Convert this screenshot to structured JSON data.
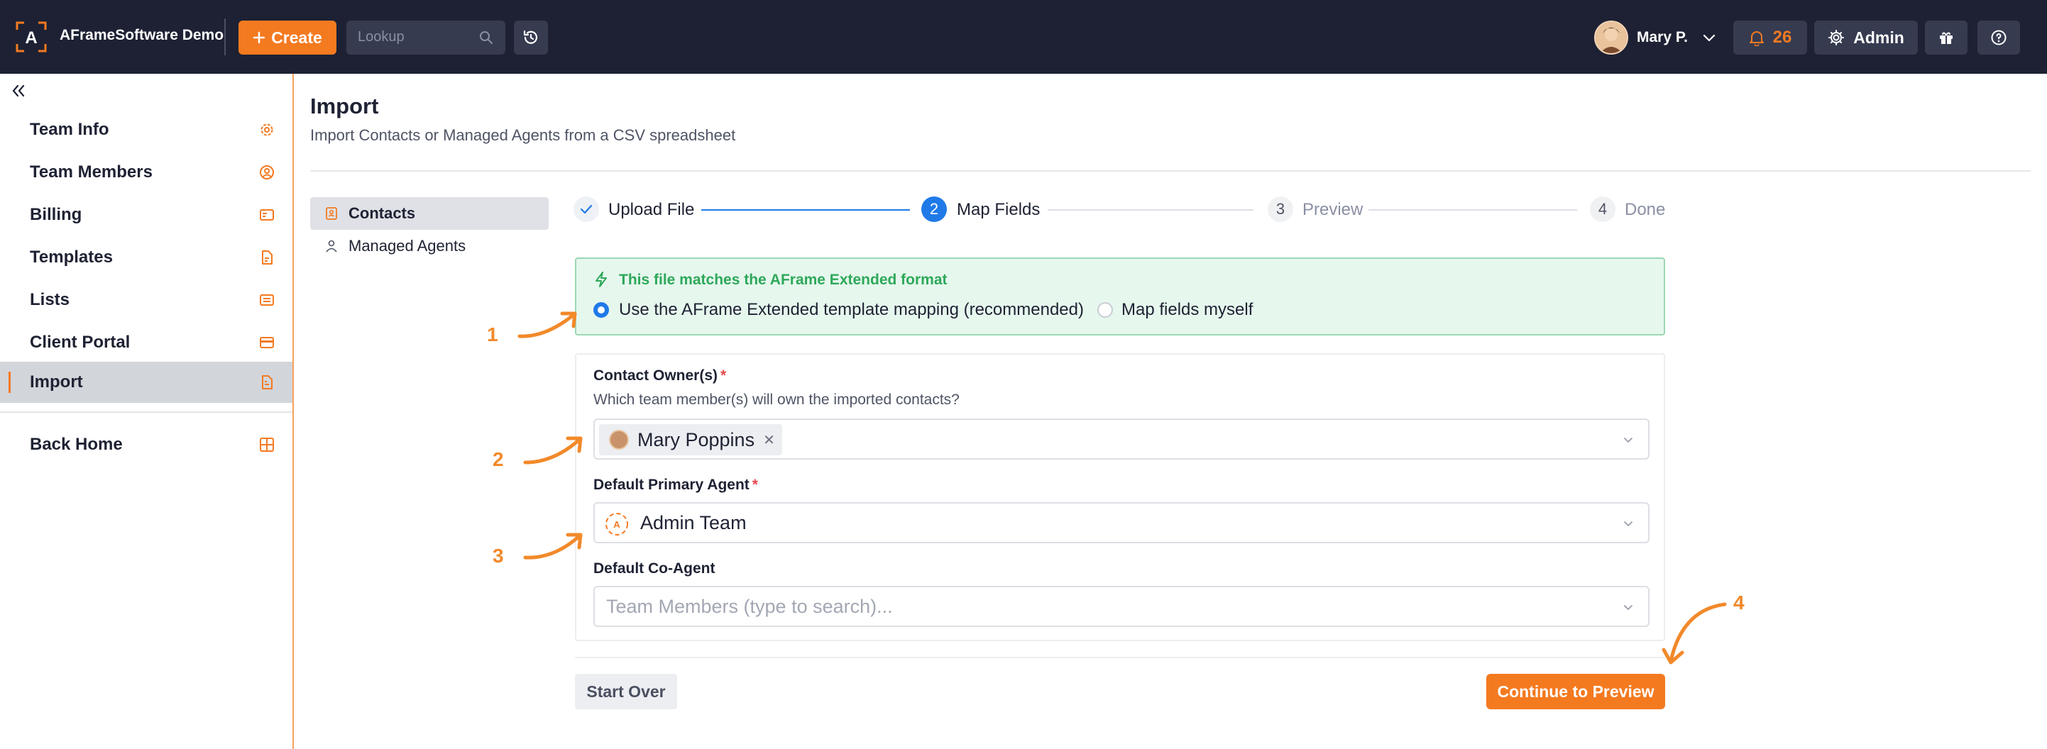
{
  "topbar": {
    "brand": "AFrameSoftware Demo",
    "create_label": "Create",
    "lookup_placeholder": "Lookup",
    "user_name": "Mary P.",
    "notification_count": "26",
    "admin_label": "Admin"
  },
  "sidebar": {
    "items": [
      {
        "label": "Team Info",
        "icon": "gear-icon"
      },
      {
        "label": "Team Members",
        "icon": "user-circle-icon"
      },
      {
        "label": "Billing",
        "icon": "card-icon"
      },
      {
        "label": "Templates",
        "icon": "document-icon"
      },
      {
        "label": "Lists",
        "icon": "list-icon"
      },
      {
        "label": "Client Portal",
        "icon": "portal-icon"
      },
      {
        "label": "Import",
        "icon": "import-file-icon",
        "active": true
      }
    ],
    "back_home": {
      "label": "Back Home",
      "icon": "grid-icon"
    }
  },
  "page": {
    "title": "Import",
    "subtitle": "Import Contacts or Managed Agents from a CSV spreadsheet"
  },
  "subnav": {
    "contacts": "Contacts",
    "managed_agents": "Managed Agents"
  },
  "stepper": {
    "steps": [
      {
        "number": "",
        "label": "Upload File",
        "state": "done"
      },
      {
        "number": "2",
        "label": "Map Fields",
        "state": "current"
      },
      {
        "number": "3",
        "label": "Preview",
        "state": "upcoming"
      },
      {
        "number": "4",
        "label": "Done",
        "state": "upcoming"
      }
    ]
  },
  "match": {
    "title": "This file matches the AFrame Extended format",
    "option_template": "Use the AFrame Extended template mapping (recommended)",
    "option_manual": "Map fields myself",
    "selected": "template"
  },
  "form": {
    "owners_label": "Contact Owner(s)",
    "owners_help": "Which team member(s) will own the imported contacts?",
    "owners_value": "Mary Poppins",
    "primary_label": "Default Primary Agent",
    "primary_value": "Admin Team",
    "coagent_label": "Default Co-Agent",
    "coagent_placeholder": "Team Members (type to search)...",
    "required_mark": "*"
  },
  "actions": {
    "start_over": "Start Over",
    "continue": "Continue to Preview"
  },
  "annotations": [
    "1",
    "2",
    "3",
    "4"
  ],
  "colors": {
    "accent": "#f47a20",
    "topbar": "#1d2133",
    "step_active": "#1f7ae8",
    "success": "#2ea85a"
  }
}
